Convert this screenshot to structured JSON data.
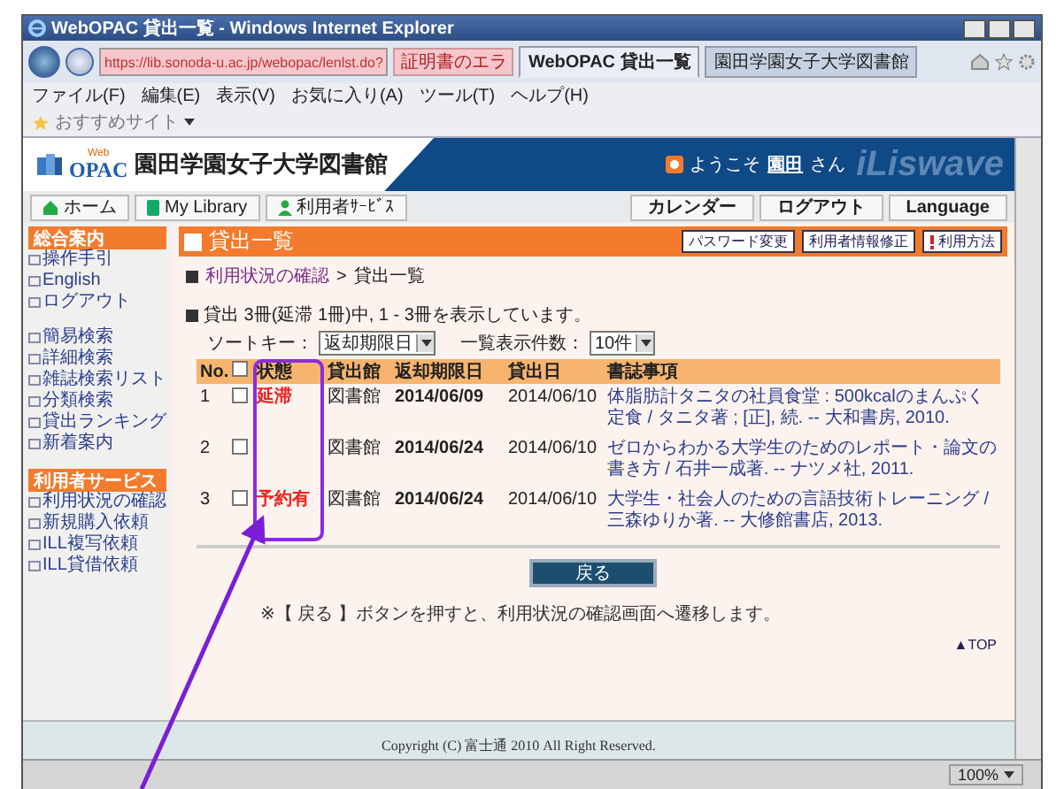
{
  "browser": {
    "title": "WebOPAC 貸出一覧 - Windows Internet Explorer",
    "address": "https://lib.sonoda-u.ac.jp/webopac/lenlst.do?",
    "cert_error": "証明書のエラ",
    "tabs": [
      {
        "label": "WebOPAC 貸出一覧",
        "selected": true
      },
      {
        "label": "園田学園女子大学図書館",
        "selected": false
      }
    ],
    "menu": [
      "ファイル(F)",
      "編集(E)",
      "表示(V)",
      "お気に入り(A)",
      "ツール(T)",
      "ヘルプ(H)"
    ],
    "favorites": "おすすめサイト",
    "zoom": "100%"
  },
  "header": {
    "logo_small": "Web",
    "logo": "OPAC",
    "library": "園田学園女子大学図書館",
    "welcome": "ようこそ",
    "user": "園田",
    "honorific": "さん",
    "brand": "iLiswave"
  },
  "nav": {
    "left": [
      "ホーム",
      "My Library",
      "利用者ｻｰﾋﾞｽ"
    ],
    "right": [
      "カレンダー",
      "ログアウト",
      "Language"
    ]
  },
  "sidebar": [
    {
      "title": "総合案内",
      "items": [
        "操作手引",
        "English",
        "ログアウト"
      ]
    },
    {
      "items": [
        "簡易検索",
        "詳細検索",
        "雑誌検索リスト",
        "分類検索",
        "貸出ランキング",
        "新着案内"
      ]
    },
    {
      "title": "利用者サービス",
      "items": [
        "利用状況の確認",
        "新規購入依頼",
        "ILL複写依頼",
        "ILL貸借依頼"
      ]
    }
  ],
  "main": {
    "title": "貸出一覧",
    "actions": [
      "パスワード変更",
      "利用者情報修正",
      "利用方法"
    ],
    "breadcrumb": {
      "link": "利用状況の確認",
      "separator": ">",
      "current": "貸出一覧"
    },
    "summary": "貸出 3冊(延滞 1冊)中, 1 - 3冊を表示しています。",
    "sort_label": "ソートキー：",
    "sort_value": "返却期限日",
    "count_label": "一覧表示件数：",
    "count_value": "10件",
    "table": {
      "columns": [
        "No.",
        "状態",
        "貸出館",
        "返却期限日",
        "貸出日",
        "書誌事項"
      ],
      "all_checked": false,
      "rows": [
        {
          "no": "1",
          "checked": false,
          "status": "延滞",
          "library": "図書館",
          "due": "2014/06/09",
          "loaned": "2014/06/10",
          "bib": "体脂肪計タニタの社員食堂 : 500kcalのまんぷく定食 / タニタ著 ; [正], 続. -- 大和書房, 2010."
        },
        {
          "no": "2",
          "checked": false,
          "library": "図書館",
          "due": "2014/06/24",
          "loaned": "2014/06/10",
          "bib": "ゼロからわかる大学生のためのレポート・論文の書き方 / 石井一成著. -- ナツメ社, 2011."
        },
        {
          "no": "3",
          "checked": false,
          "status": "予約有",
          "library": "図書館",
          "due": "2014/06/24",
          "loaned": "2014/06/10",
          "bib": "大学生・社会人のための言語技術トレーニング / 三森ゆりか著. -- 大修館書店, 2013."
        }
      ]
    },
    "back_button": "戻る",
    "note": "※【 戻る 】ボタンを押すと、利用状況の確認画面へ遷移します。",
    "top_link": "▲TOP"
  },
  "footer": "Copyright (C) 富士通 2010 All Right Reserved."
}
